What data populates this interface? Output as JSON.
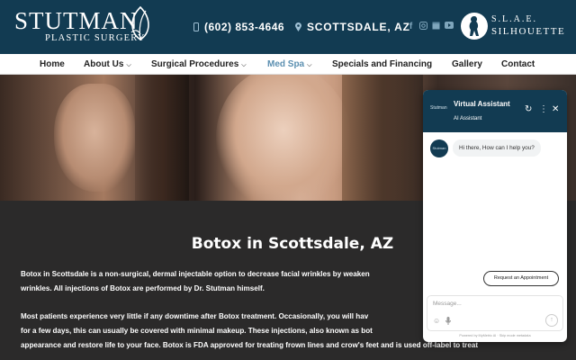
{
  "header": {
    "logo_main": "STUTMAN",
    "logo_sub": "PLASTIC SURGERY",
    "phone": "(602) 853-4646",
    "location": "SCOTTSDALE, AZ",
    "socials": [
      "facebook-icon",
      "instagram-icon",
      "google-my-business-icon",
      "youtube-icon"
    ],
    "slae_title": "S.L.A.E.",
    "slae_sub": "SILHOUETTE"
  },
  "nav": {
    "items": [
      {
        "label": "Home",
        "dropdown": false
      },
      {
        "label": "About Us",
        "dropdown": true
      },
      {
        "label": "Surgical Procedures",
        "dropdown": true
      },
      {
        "label": "Med Spa",
        "dropdown": true,
        "active": true
      },
      {
        "label": "Specials and Financing",
        "dropdown": false
      },
      {
        "label": "Gallery",
        "dropdown": false
      },
      {
        "label": "Contact",
        "dropdown": false
      }
    ]
  },
  "main": {
    "title": "Botox in Scottsdale, AZ",
    "para1_line1": "Botox in Scottsdale is a non-surgical, dermal injectable option to decrease facial wrinkles by weaken",
    "para1_line2": "wrinkles. All injections of Botox are performed by Dr. Stutman himself.",
    "para2_line1": "Most patients experience very little if any downtime after Botox treatment. Occasionally, you will hav",
    "para2_line2": "for a few days, this can usually be covered with minimal makeup. These injections, also known as bot",
    "para2_line3": "appearance and restore life to your face. Botox is FDA approved for treating frown lines and crow's feet and is used off-label to treat"
  },
  "chat": {
    "title": "Virtual Assistant",
    "subtitle": "AI Assistant",
    "logo_text": "Stutman",
    "greeting": "Hi there, How can I help you?",
    "appointment_button": "Request an Appointment",
    "input_placeholder": "Message...",
    "powered_by": "Powered by MyMetric AI · Skip mode metadata",
    "colors": {
      "header": "#123b52",
      "accent": "#123b52"
    }
  },
  "colors": {
    "topbar": "#123b52",
    "nav_active": "#5b8fb0",
    "content_bg": "#2b2a2a"
  }
}
